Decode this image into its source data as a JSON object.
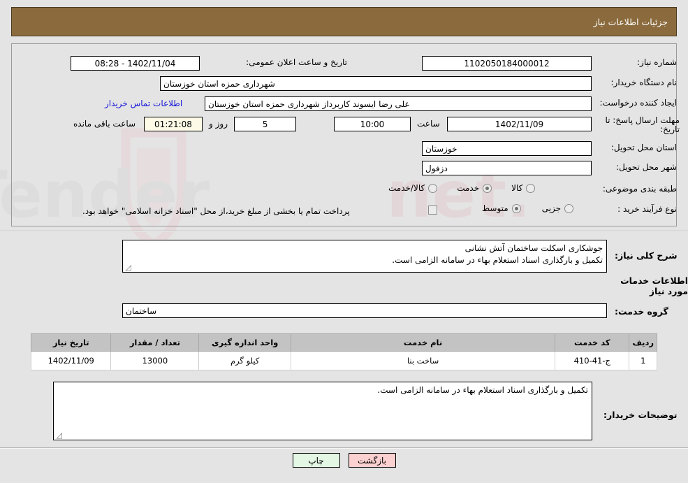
{
  "header": {
    "title": "جزئیات اطلاعات نیاز"
  },
  "colors": {
    "header_bar": "#8b6b3d",
    "header_text": "#ffffff",
    "page_bg": "#e4e4e4",
    "link": "#1414d8",
    "table_header_bg": "#c3c3c3",
    "back_button_bg": "#fbd0d0",
    "print_button_bg": "#e4f6e4",
    "countdown_bg": "#fdfbe8"
  },
  "summary": {
    "need_number_label": "شماره نیاز:",
    "need_number_value": "1102050184000012",
    "announce_label": "تاریخ و ساعت اعلان عمومی:",
    "announce_value": "1402/11/04 - 08:28",
    "buyer_org_label": "نام دستگاه خریدار:",
    "buyer_org_value": "شهرداری حمزه استان خوزستان",
    "requester_label": "ایجاد کننده درخواست:",
    "requester_value": "علی رضا ایسوند کاربرداز شهرداری حمزه استان خوزستان",
    "contact_link": "اطلاعات تماس خریدار",
    "deadline_label": "مهلت ارسال پاسخ: تا تاریخ:",
    "deadline_date": "1402/11/09",
    "hour_label": "ساعت",
    "deadline_time": "10:00",
    "days_value": "5",
    "days_label": "روز و",
    "countdown_value": "01:21:08",
    "remaining_label": "ساعت باقی مانده",
    "province_label": "استان محل تحویل:",
    "province_value": "خوزستان",
    "city_label": "شهر محل تحویل:",
    "city_value": "دزفول",
    "category_label": "طبقه بندی موضوعی:",
    "category_options": [
      {
        "label": "کالا",
        "selected": false
      },
      {
        "label": "خدمت",
        "selected": true
      },
      {
        "label": "کالا/خدمت",
        "selected": false
      }
    ],
    "process_label": "نوع فرآیند خرید :",
    "process_options": [
      {
        "label": "جزیی",
        "selected": false
      },
      {
        "label": "متوسط",
        "selected": true
      }
    ],
    "treasury_checkbox_checked": false,
    "treasury_note": "پرداخت تمام یا بخشی از مبلغ خرید،از محل \"اسناد خزانه اسلامی\" خواهد بود."
  },
  "need_description": {
    "label": "شرح کلی نیاز:",
    "line1": "جوشکاری اسکلت ساختمان آتش نشانی",
    "line2": "تکمیل و بارگذاری اسناد استعلام بهاء در سامانه الزامی است."
  },
  "services_section": {
    "title": "اطلاعات خدمات مورد نیاز",
    "group_label": "گروه خدمت:",
    "group_value": "ساختمان"
  },
  "table": {
    "columns": [
      "ردیف",
      "کد خدمت",
      "نام خدمت",
      "واحد اندازه گیری",
      "تعداد / مقدار",
      "تاریخ نیاز"
    ],
    "rows": [
      {
        "row": "1",
        "code": "ج-41-410",
        "name": "ساخت بنا",
        "unit": "کیلو گرم",
        "qty": "13000",
        "date": "1402/11/09"
      }
    ]
  },
  "buyer_notes": {
    "label": "توضیحات خریدار:",
    "text": "تکمیل و بارگذاری اسناد استعلام بهاء در سامانه الزامی است."
  },
  "footer": {
    "back_label": "بازگشت",
    "print_label": "چاپ"
  },
  "watermark": {
    "text": "AriaTender.net"
  }
}
